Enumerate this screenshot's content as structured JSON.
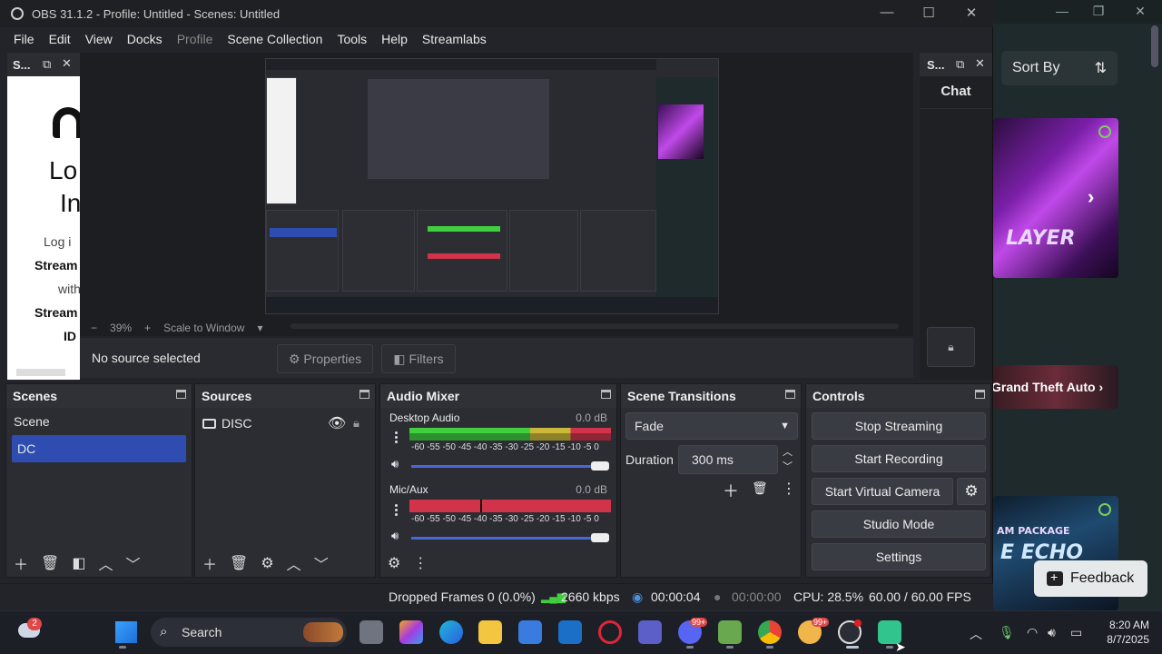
{
  "window": {
    "title": "OBS 31.1.2 - Profile: Untitled - Scenes: Untitled"
  },
  "menu": [
    "File",
    "Edit",
    "View",
    "Docks",
    "Profile",
    "Scene Collection",
    "Tools",
    "Help",
    "Streamlabs"
  ],
  "left_dock": {
    "title": "S...",
    "lines": [
      "Lo",
      "In",
      "Log i",
      "Stream",
      "with",
      "Stream",
      "ID"
    ]
  },
  "right_dock": {
    "title": "S...",
    "chat_title": "Chat"
  },
  "preview": {
    "zoom": "39%",
    "scale_mode": "Scale to Window",
    "no_source": "No source selected",
    "properties_label": "Properties",
    "filters_label": "Filters"
  },
  "scenes": {
    "title": "Scenes",
    "items": [
      "Scene",
      "DC"
    ],
    "selected": "DC"
  },
  "sources": {
    "title": "Sources",
    "items": [
      {
        "name": "DISC"
      }
    ]
  },
  "audio_mixer": {
    "title": "Audio Mixer",
    "channels": [
      {
        "name": "Desktop Audio",
        "db": "0.0 dB"
      },
      {
        "name": "Mic/Aux",
        "db": "0.0 dB"
      }
    ],
    "ticks": "-60 -55 -50 -45 -40 -35 -30 -25 -20 -15 -10 -5 0"
  },
  "transitions": {
    "title": "Scene Transitions",
    "selected": "Fade",
    "duration_label": "Duration",
    "duration_value": "300 ms"
  },
  "controls": {
    "title": "Controls",
    "buttons": [
      "Stop Streaming",
      "Start Recording",
      "Start Virtual Camera",
      "Studio Mode",
      "Settings"
    ]
  },
  "status": {
    "dropped": "Dropped Frames 0 (0.0%)",
    "bitrate": "2660 kbps",
    "stream_time": "00:00:04",
    "rec_time": "00:00:00",
    "cpu": "CPU: 28.5%",
    "fps": "60.00 / 60.00 FPS"
  },
  "bg_page": {
    "sort_label": "Sort By",
    "gta_label": "Grand Theft Auto",
    "feedback": "Feedback",
    "thumb1_text": "LAYER",
    "thumb3_text": "E ECHO",
    "thumb3_sub": "AM PACKAGE"
  },
  "taskbar": {
    "search": "Search",
    "weather_badge": "2",
    "badge_99": "99+",
    "time": "8:20 AM",
    "date": "8/7/2025"
  },
  "colors": {
    "selected_scene": "#2f4db0",
    "meter_green": "#3fcf3f",
    "meter_red": "#d0334a",
    "volume_track": "#4a67d8"
  }
}
